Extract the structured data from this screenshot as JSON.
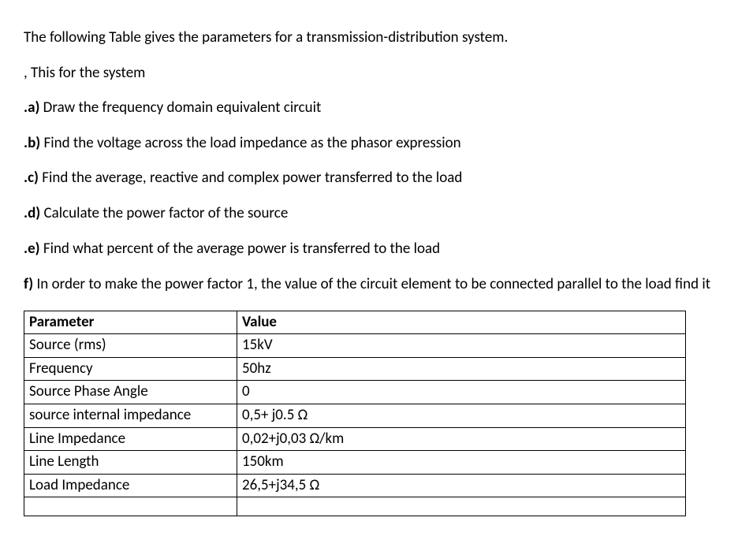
{
  "intro": "The following Table gives the parameters for a transmission-distribution system.",
  "sub_intro": ", This for the system",
  "questions": {
    "a": {
      "label": ".a)",
      "text": " Draw the frequency domain equivalent circuit"
    },
    "b": {
      "label": ".b)",
      "text": " Find the voltage across the load impedance as the phasor expression"
    },
    "c": {
      "label": ".c)",
      "text": " Find the average, reactive and complex power transferred to the load"
    },
    "d": {
      "label": ".d)",
      "text": " Calculate the power factor of the source"
    },
    "e": {
      "label": ".e)",
      "text": " Find what percent of the average power is transferred to the load"
    },
    "f": {
      "label": "f)",
      "text": " In order to make the power factor 1, the value of the circuit element to be connected parallel to the load find it"
    }
  },
  "table": {
    "header": {
      "param": "Parameter",
      "value": "Value"
    },
    "rows": [
      {
        "param": "Source (rms)",
        "value": "15kV"
      },
      {
        "param": "Frequency",
        "value": "50hz"
      },
      {
        "param": "Source Phase Angle",
        "value": "0"
      },
      {
        "param": "source internal impedance",
        "value": "0,5+ j0.5 Ω"
      },
      {
        "param": "Line Impedance",
        "value": "0,02+j0,03 Ω/km"
      },
      {
        "param": "Line Length",
        "value": "150km"
      },
      {
        "param": "Load Impedance",
        "value": "26,5+j34,5 Ω"
      }
    ]
  }
}
